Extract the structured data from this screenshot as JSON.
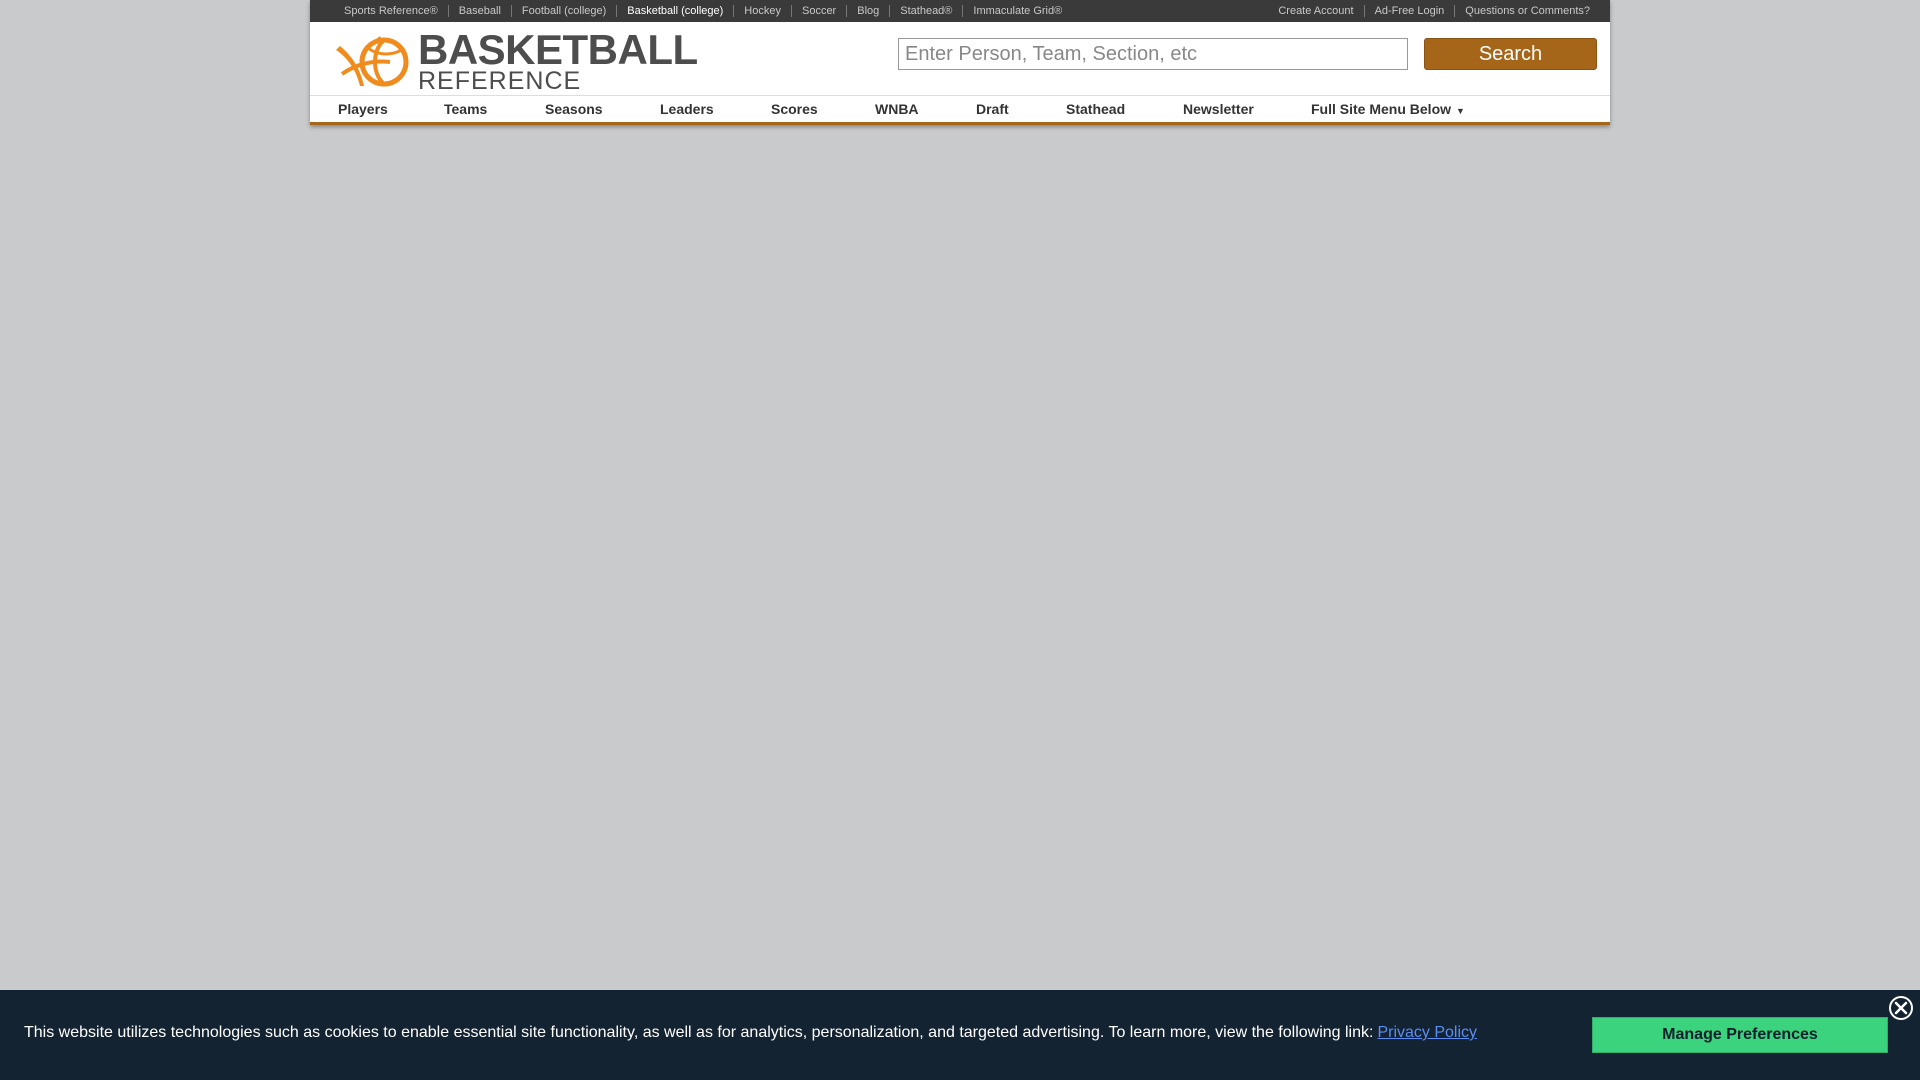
{
  "topbar": {
    "left_links": [
      {
        "label": "Sports Reference®",
        "active": false
      },
      {
        "label": "Baseball",
        "active": false
      },
      {
        "label": "Football (college)",
        "active": false
      },
      {
        "label": "Basketball (college)",
        "active": true
      },
      {
        "label": "Hockey",
        "active": false
      },
      {
        "label": "Soccer",
        "active": false
      },
      {
        "label": "Blog",
        "active": false
      },
      {
        "label": "Stathead®",
        "active": false
      },
      {
        "label": "Immaculate Grid®",
        "active": false
      }
    ],
    "right_links": [
      {
        "label": "Create Account"
      },
      {
        "label": "Ad-Free Login"
      },
      {
        "label": "Questions or Comments?"
      }
    ]
  },
  "logo": {
    "line1": "BASKETBALL",
    "line2": "REFERENCE",
    "accent_color": "#f08c1e"
  },
  "search": {
    "placeholder": "Enter Person, Team, Section, etc",
    "value": "",
    "button_label": "Search"
  },
  "nav": {
    "items": [
      {
        "label": "Players"
      },
      {
        "label": "Teams"
      },
      {
        "label": "Seasons"
      },
      {
        "label": "Leaders"
      },
      {
        "label": "Scores"
      },
      {
        "label": "WNBA"
      },
      {
        "label": "Draft"
      },
      {
        "label": "Stathead"
      },
      {
        "label": "Newsletter"
      },
      {
        "label": "Full Site Menu Below",
        "has_dropdown": true
      }
    ]
  },
  "cookie_banner": {
    "text": "This website utilizes technologies such as cookies to enable essential site functionality, as well as for analytics, personalization, and targeted advertising. To learn more, view the following link:",
    "link_label": "Privacy Policy",
    "button_label": "Manage Preferences",
    "close_icon": "close-icon"
  },
  "colors": {
    "page_background": "#c9cacc",
    "accent": "#a5661a",
    "banner_background": "#142332",
    "primary_button": "#3bd37d",
    "link": "#5b8df2"
  }
}
